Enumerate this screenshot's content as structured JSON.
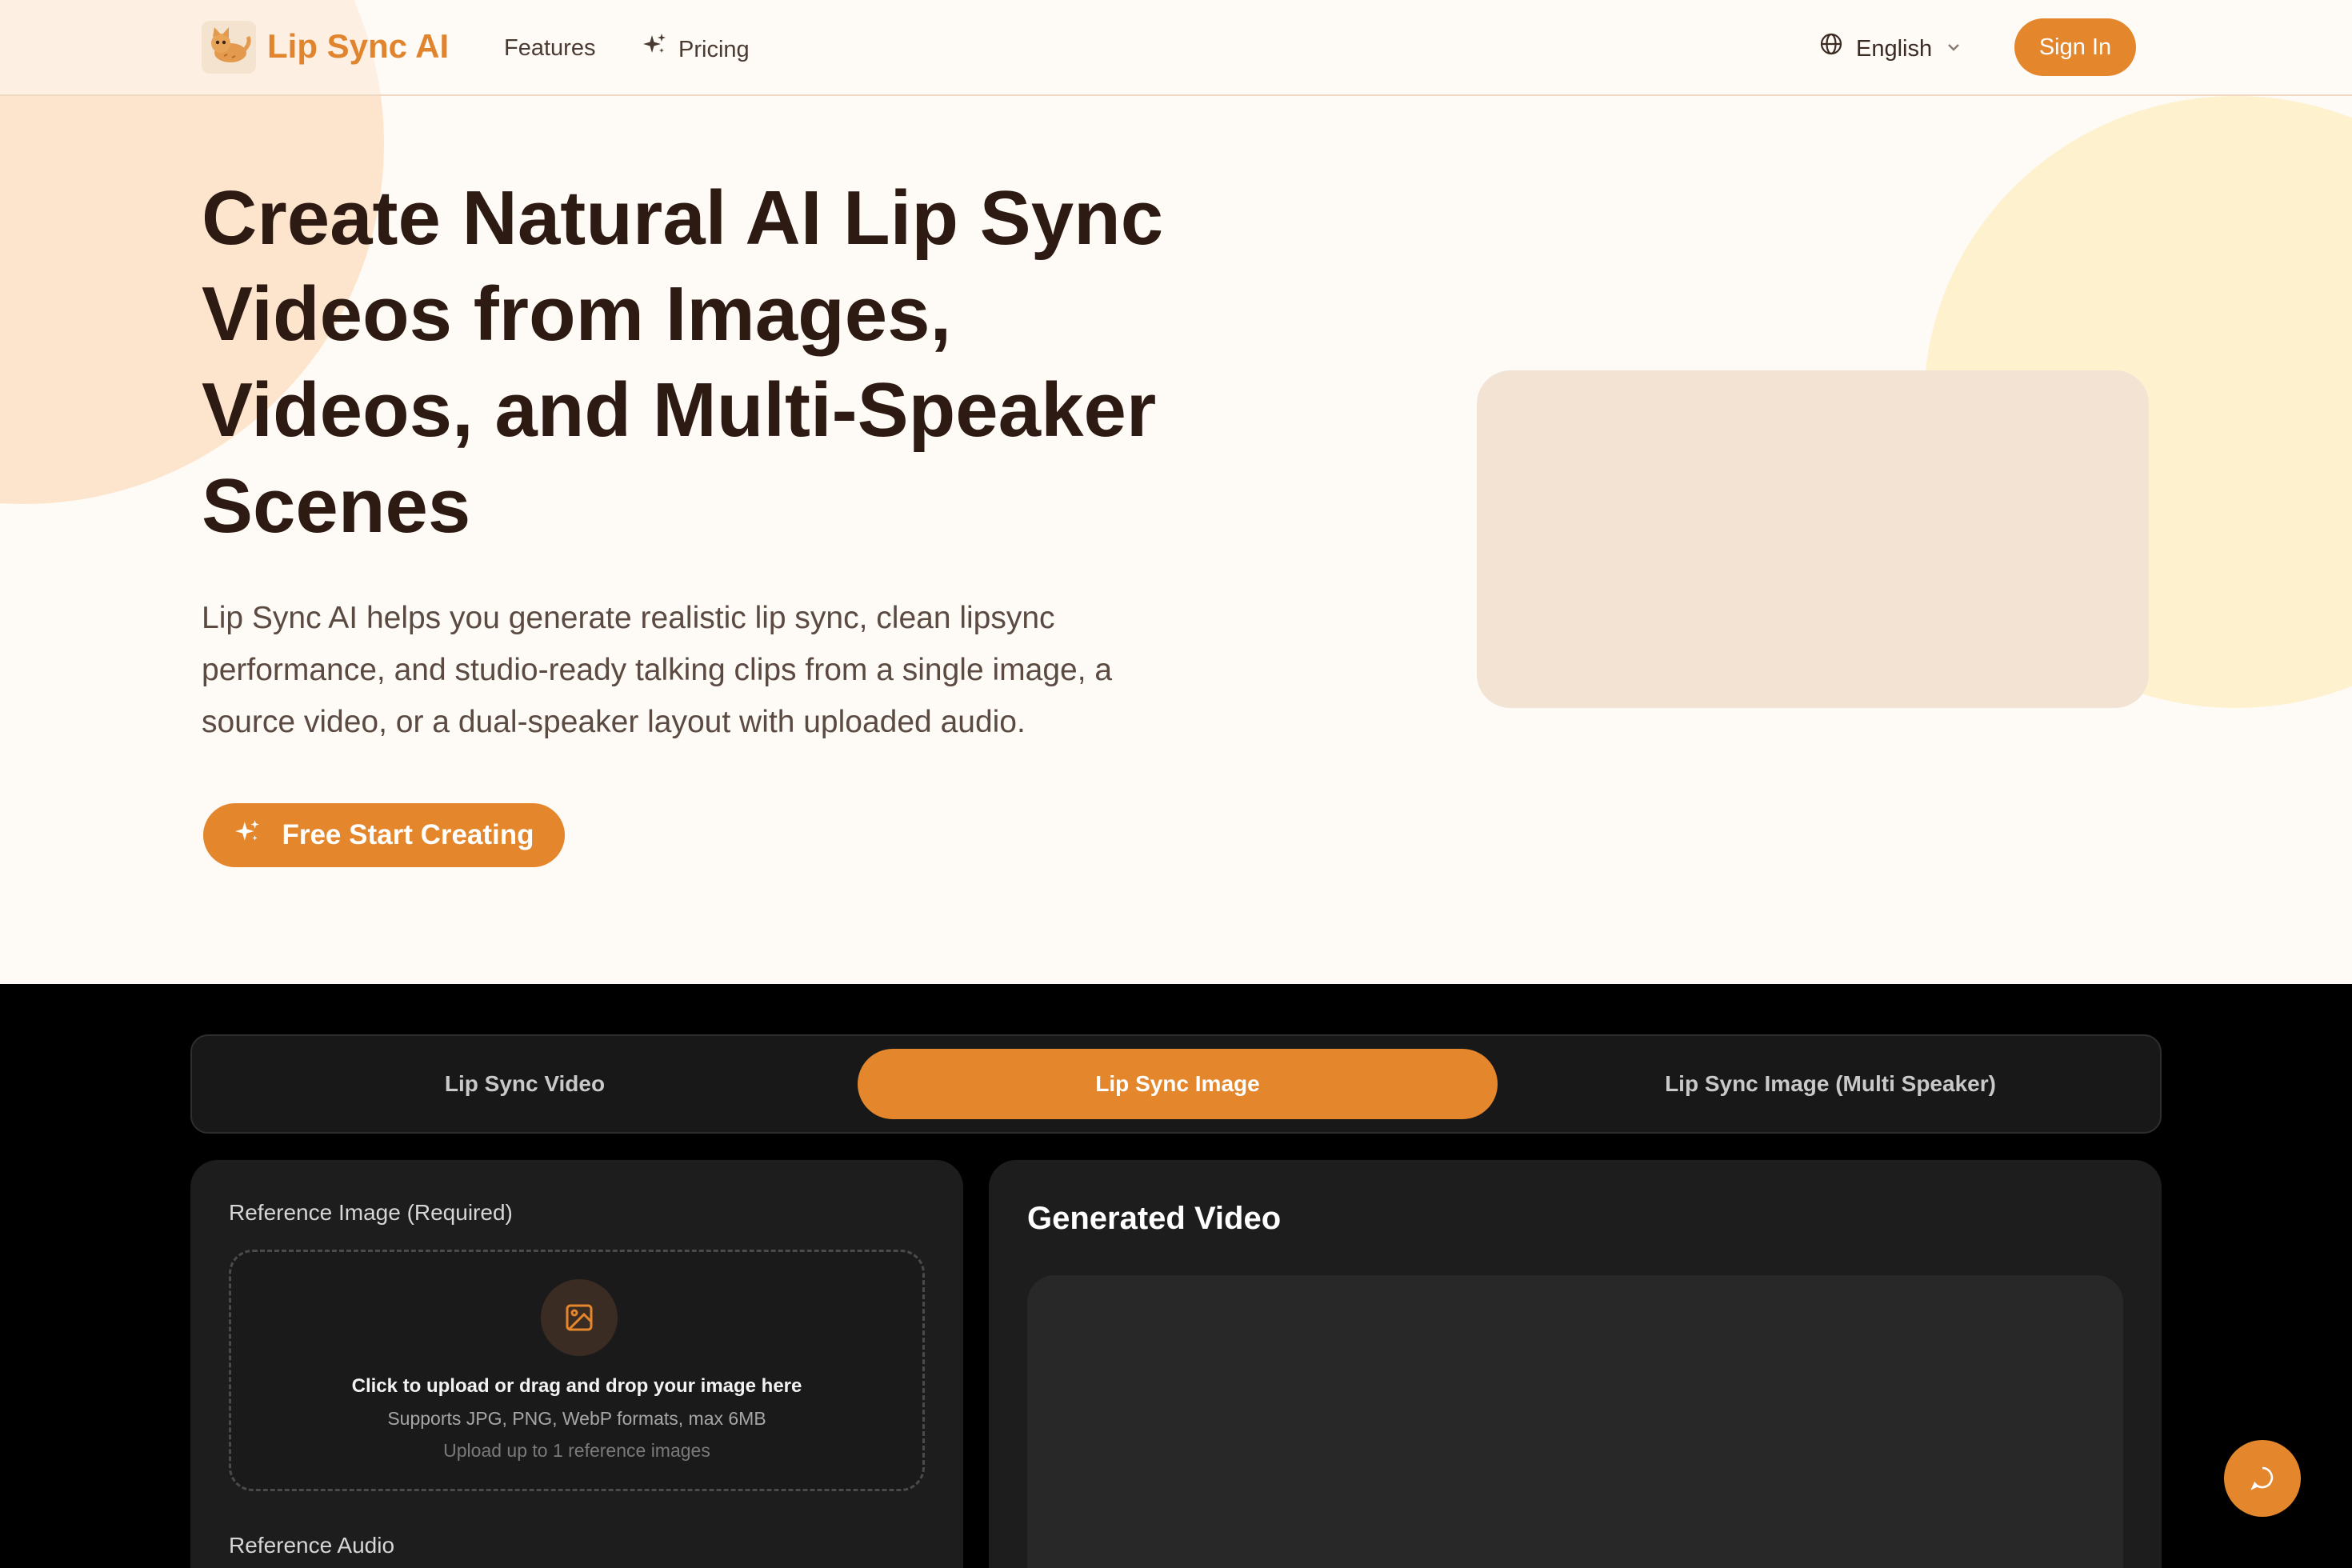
{
  "header": {
    "brand": "Lip Sync AI",
    "logo_icon": "cat-mascot-icon",
    "nav": {
      "features": "Features",
      "pricing": "Pricing"
    },
    "language": "English",
    "sign_in": "Sign In"
  },
  "hero": {
    "title": "Create Natural AI Lip Sync Videos from Images, Videos, and Multi-Speaker Scenes",
    "description": "Lip Sync AI helps you generate realistic lip sync, clean lipsync performance, and studio-ready talking clips from a single image, a source video, or a dual-speaker layout with uploaded audio.",
    "cta": "Free Start Creating"
  },
  "tabs": [
    {
      "label": "Lip Sync Video",
      "active": false
    },
    {
      "label": "Lip Sync Image",
      "active": true
    },
    {
      "label": "Lip Sync Image (Multi Speaker)",
      "active": false
    }
  ],
  "form": {
    "reference_image_label": "Reference Image (Required)",
    "upload_main": "Click to upload or drag and drop your image here",
    "upload_formats": "Supports JPG, PNG, WebP formats, max 6MB",
    "upload_limit": "Upload up to 1 reference images",
    "reference_audio_label": "Reference Audio"
  },
  "output": {
    "title": "Generated Video"
  },
  "colors": {
    "accent": "#e3862c",
    "hero_bg": "#fefaf5",
    "heading": "#2d1a12",
    "dark_bg": "#000000",
    "panel_bg": "#1d1d1d"
  }
}
